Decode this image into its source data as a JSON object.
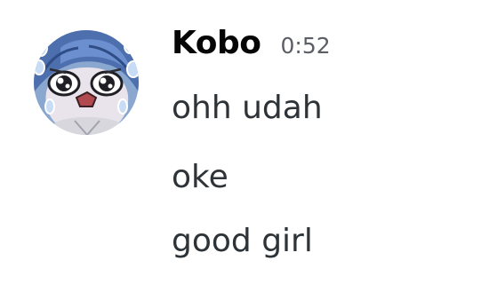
{
  "message_group": {
    "author": {
      "name": "Kobo",
      "avatar_icon": "anime-crying-avatar-icon"
    },
    "timestamp": "0:52",
    "messages": [
      {
        "text": "ohh udah"
      },
      {
        "text": "oke"
      },
      {
        "text": "good girl"
      }
    ]
  },
  "colors": {
    "background": "#ffffff",
    "username": "#060607",
    "timestamp": "#5c5e66",
    "message_text": "#2e3338"
  }
}
